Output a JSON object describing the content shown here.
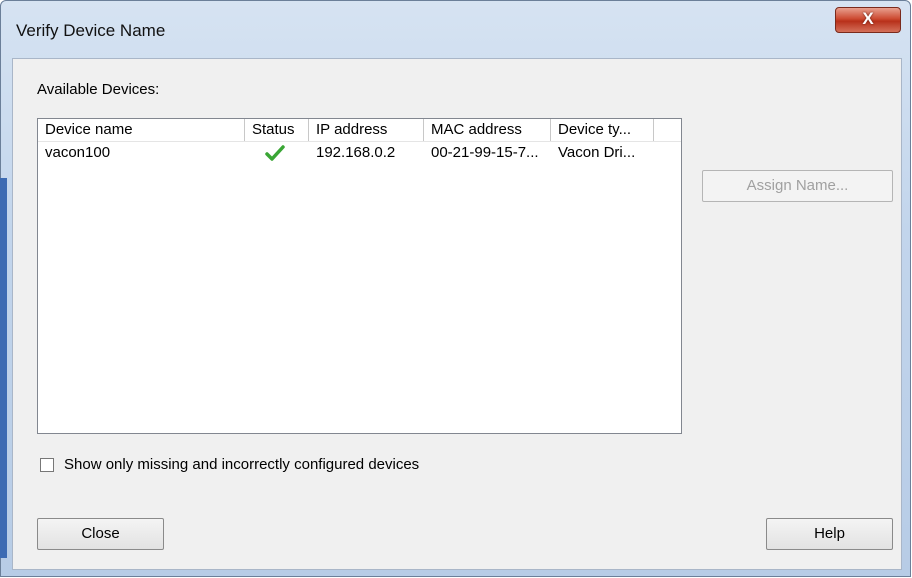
{
  "window": {
    "title": "Verify Device Name",
    "close_glyph": "X"
  },
  "available_label": "Available Devices:",
  "table": {
    "columns": [
      "Device name",
      "Status",
      "IP address",
      "MAC address",
      "Device ty..."
    ],
    "rows": [
      {
        "device_name": "vacon100",
        "status_icon": "green-check-icon",
        "ip": "192.168.0.2",
        "mac": "00-21-99-15-7...",
        "device_type": "Vacon Dri..."
      }
    ]
  },
  "assign_button": "Assign Name...",
  "filter_checkbox": {
    "label": "Show only missing and incorrectly configured devices",
    "checked": false
  },
  "close_button": "Close",
  "help_button": "Help",
  "colors": {
    "status_ok": "#3aa635",
    "title_close": "#c9432c"
  }
}
